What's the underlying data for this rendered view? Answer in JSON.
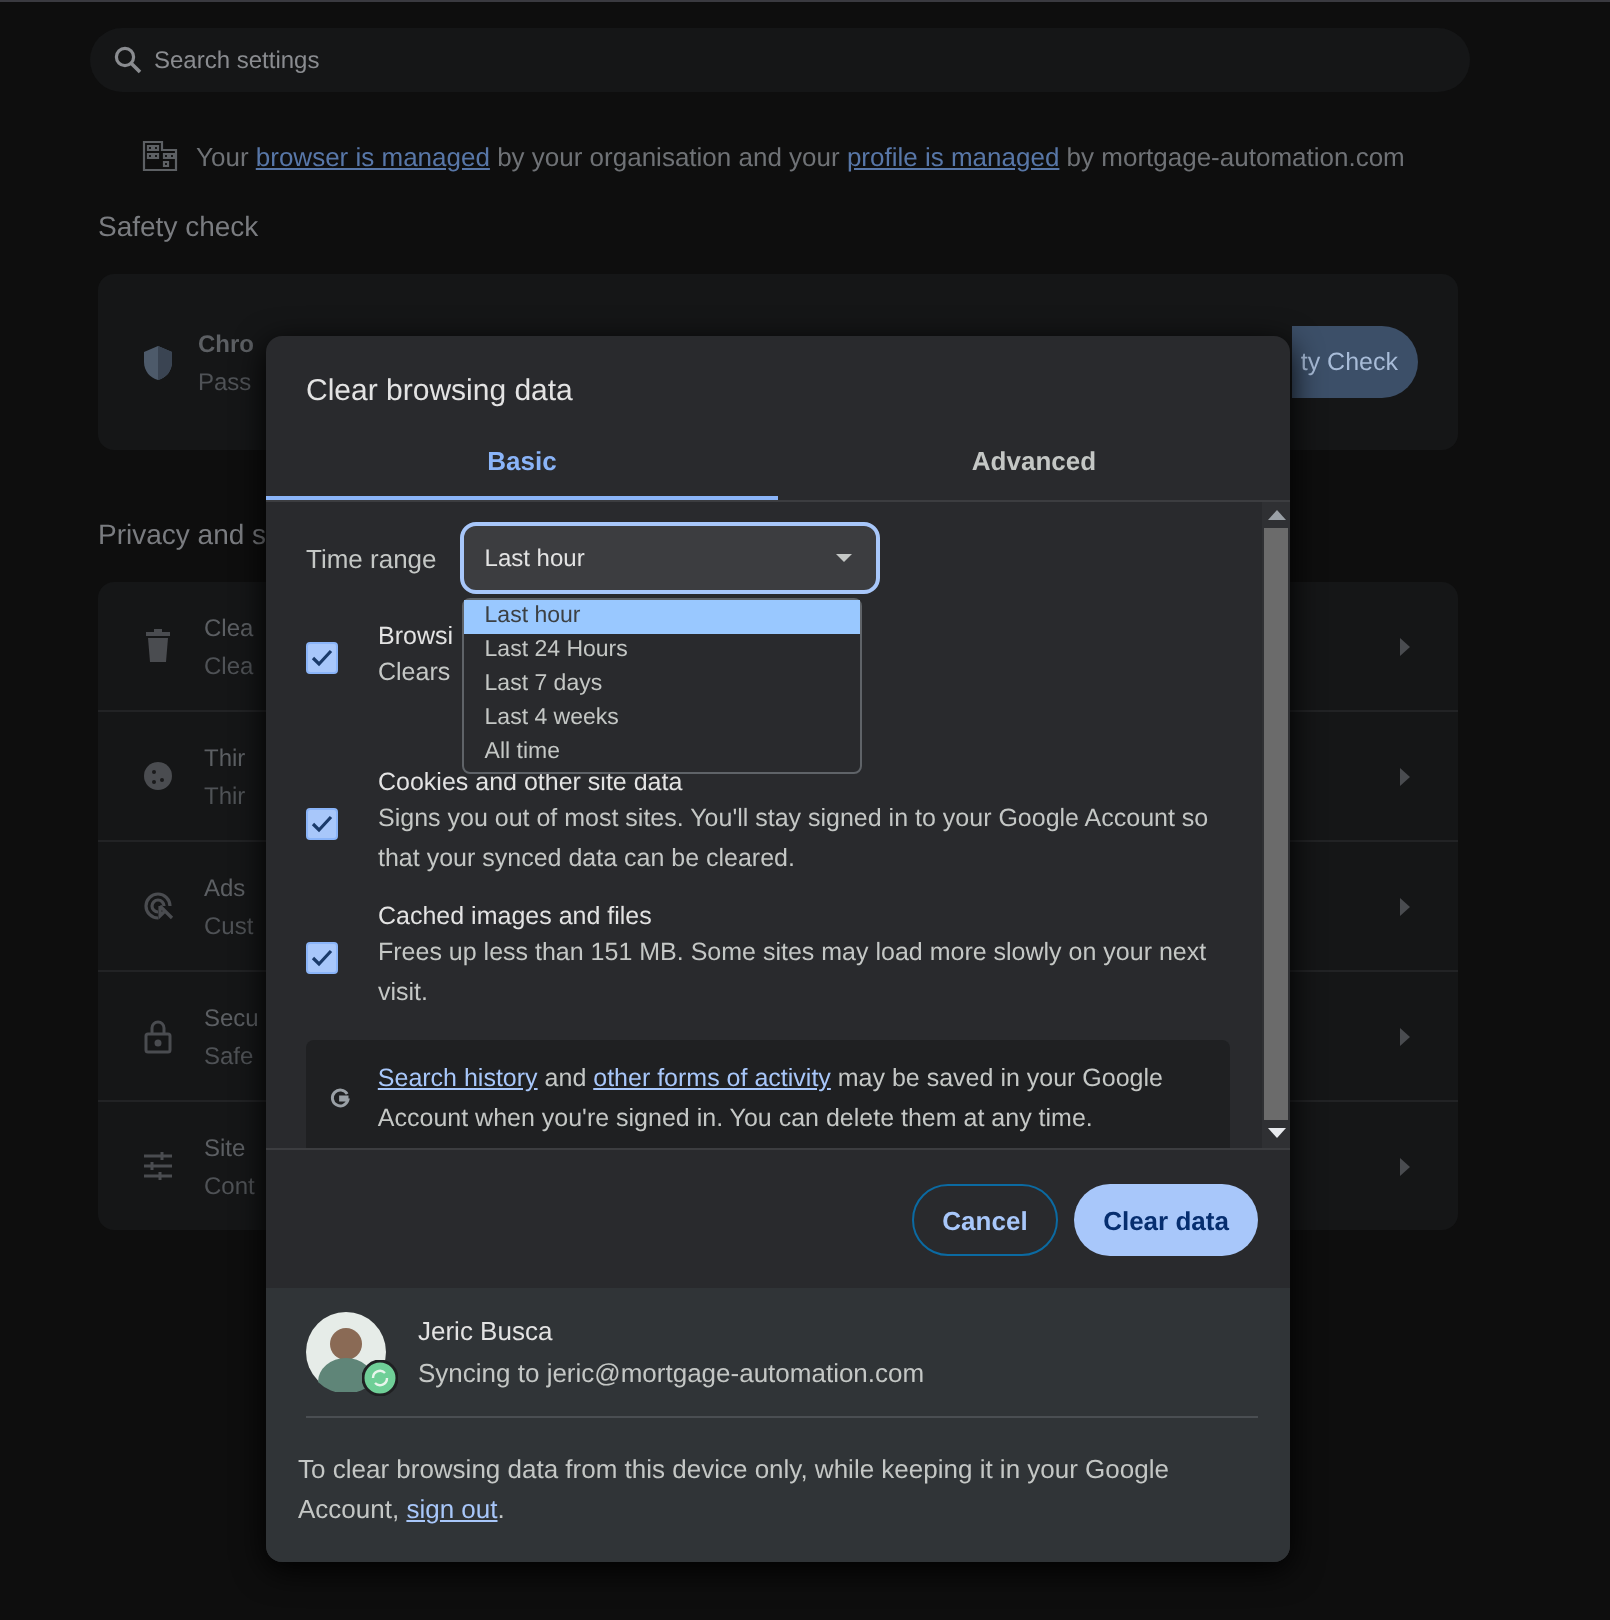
{
  "search": {
    "placeholder": "Search settings"
  },
  "notice": {
    "before": "Your",
    "link1": "browser is managed",
    "middle": "by your organisation and your",
    "link2": "profile is managed",
    "after": "by mortgage-automation.com"
  },
  "safety_check": {
    "heading": "Safety check",
    "title": "Chro",
    "subtitle": "Pass",
    "button": "ty Check"
  },
  "privacy": {
    "heading": "Privacy and s",
    "rows": [
      {
        "kind": "trash",
        "title": "Clea",
        "subtitle": "Clea"
      },
      {
        "kind": "cookie",
        "title": "Thir",
        "subtitle": "Thir"
      },
      {
        "kind": "ads",
        "title": "Ads",
        "subtitle": "Cust"
      },
      {
        "kind": "lock",
        "title": "Secu",
        "subtitle": "Safe"
      },
      {
        "kind": "tune",
        "title": "Site",
        "subtitle": "Cont"
      }
    ]
  },
  "dialog": {
    "title": "Clear browsing data",
    "tabs": [
      {
        "label": "Basic",
        "selected": true
      },
      {
        "label": "Advanced",
        "selected": false
      }
    ],
    "time_range": {
      "label": "Time range",
      "value": "Last hour",
      "expanded": true,
      "options": [
        {
          "label": "Last hour",
          "selected": true
        },
        {
          "label": "Last 24 Hours",
          "selected": false
        },
        {
          "label": "Last 7 days",
          "selected": false
        },
        {
          "label": "Last 4 weeks",
          "selected": false
        },
        {
          "label": "All time",
          "selected": false
        }
      ]
    },
    "items": [
      {
        "title": "Browsi",
        "description": "Clears",
        "checked": true
      },
      {
        "title": "Cookies and other site data",
        "description": "Signs you out of most sites. You'll stay signed in to your Google Account so that your synced data can be cleared.",
        "checked": true
      },
      {
        "title": "Cached images and files",
        "description": "Frees up less than 151 MB. Some sites may load more slowly on your next visit.",
        "checked": true
      }
    ],
    "info": {
      "link1": "Search history",
      "middle": "and",
      "link2": "other forms of activity",
      "after": "may be saved in your Google Account when you're signed in. You can delete them at any time."
    },
    "cancel": "Cancel",
    "confirm": "Clear data",
    "account": {
      "name": "Jeric Busca",
      "status": "Syncing to jeric@mortgage-automation.com"
    },
    "footer": {
      "text": "To clear browsing data from this device only, while keeping it in your Google Account,",
      "link": "sign out",
      "after": "."
    }
  }
}
